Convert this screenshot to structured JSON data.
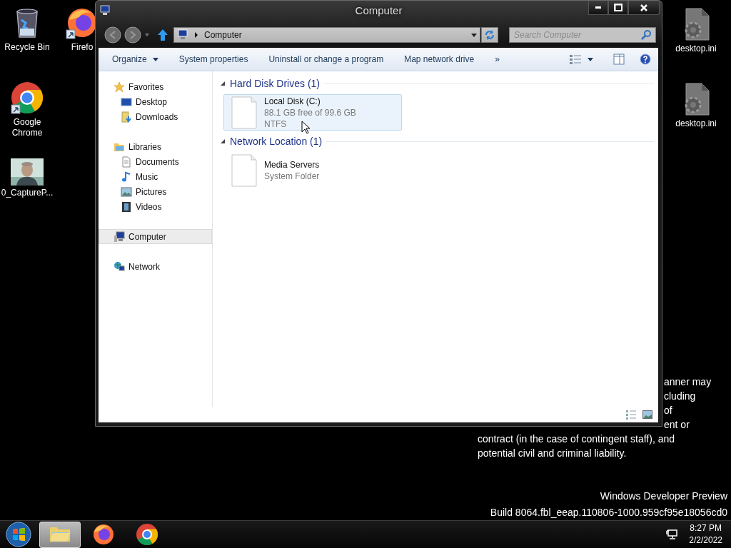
{
  "desktop_icons_left": [
    {
      "label": "Recycle Bin",
      "kind": "recycle"
    },
    {
      "label": "Firefo",
      "kind": "firefox"
    },
    {
      "label": "Google Chrome",
      "kind": "chrome"
    },
    {
      "label": "0_CaptureP..."
    }
  ],
  "desktop_icons_right": [
    {
      "label": "desktop.ini",
      "kind": "ini"
    },
    {
      "label": "desktop.ini",
      "kind": "ini"
    }
  ],
  "background_text": {
    "cut_lines": [
      "anner may",
      "cluding",
      "of",
      "ent or"
    ],
    "lines": [
      "contract (in the case of contingent staff), and",
      "potential civil and criminal liability."
    ]
  },
  "watermark_lines": [
    "Windows Developer Preview",
    "Build 8064.fbl_eeap.110806-1000.959cf95e18056cd0"
  ],
  "window": {
    "title": "Computer",
    "address": {
      "path": "Computer"
    },
    "search": {
      "placeholder": "Search Computer"
    },
    "command_bar": [
      {
        "label": "Organize",
        "kind": "menu"
      },
      {
        "label": "System properties",
        "kind": "button"
      },
      {
        "label": "Uninstall or change a program",
        "kind": "button"
      },
      {
        "label": "Map network drive",
        "kind": "button"
      },
      {
        "label": "»",
        "kind": "more"
      }
    ],
    "navigation_pane": [
      {
        "label": "Favorites",
        "kind": "favorites",
        "selected": false,
        "children": [
          {
            "label": "Desktop",
            "kind": "desktop",
            "selected": false
          },
          {
            "label": "Downloads",
            "kind": "downloads",
            "selected": false
          }
        ]
      },
      {
        "label": "Libraries",
        "kind": "libraries",
        "selected": false,
        "children": [
          {
            "label": "Documents",
            "kind": "documents",
            "selected": false
          },
          {
            "label": "Music",
            "kind": "music",
            "selected": false
          },
          {
            "label": "Pictures",
            "kind": "pictures",
            "selected": false
          },
          {
            "label": "Videos",
            "kind": "videos",
            "selected": false
          }
        ]
      },
      {
        "label": "Computer",
        "kind": "computer",
        "selected": true
      },
      {
        "label": "Network",
        "kind": "network",
        "selected": false
      }
    ],
    "groups": [
      {
        "title": "Hard Disk Drives (1)",
        "expanded": true,
        "items": [
          {
            "name": "Local Disk (C:)",
            "details": [
              "88.1 GB free of 99.6 GB",
              "NTFS"
            ],
            "selected": true
          }
        ]
      },
      {
        "title": "Network Location (1)",
        "expanded": true,
        "items": [
          {
            "name": "Media Servers",
            "details": [
              "System Folder"
            ],
            "selected": false
          }
        ]
      }
    ]
  },
  "taskbar": {
    "apps": [
      {
        "kind": "explorer",
        "selected": true
      },
      {
        "kind": "firefox",
        "selected": false
      },
      {
        "kind": "chrome",
        "selected": false
      }
    ],
    "time": "8:27 PM",
    "date": "2/2/2022"
  }
}
